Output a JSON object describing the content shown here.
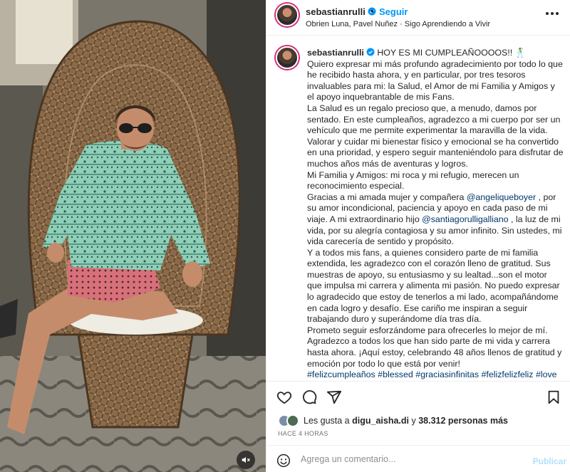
{
  "header": {
    "username": "sebastianrulli",
    "separator": "•",
    "follow_label": "Seguir",
    "subtitle": "Obrien Luna, Pavel Nuñez · Sigo Aprendiendo a Vivir"
  },
  "caption": {
    "username": "sebastianrulli",
    "headline": "HOY ES MI CUMPLEAÑOOOOS!! 🕺",
    "p1": "Quiero expresar mi más profundo agradecimiento por todo lo que he recibido hasta ahora, y en particular, por tres tesoros invaluables para mi: la Salud, el Amor de mi Familia y Amigos y el apoyo inquebrantable de mis Fans.",
    "p2": "La Salud es un regalo precioso que, a menudo, damos por sentado. En este cumpleaños, agradezco a mi cuerpo por ser un vehículo que me permite experimentar la maravilla de la vida. Valorar y cuidar mi bienestar físico y emocional se ha convertido en una prioridad, y espero seguir manteniéndolo para disfrutar de muchos años más de aventuras y logros.",
    "p3": "Mi Familia y Amigos: mi roca y mi refugio, merecen un reconocimiento especial.",
    "p4a": "Gracias a mi amada mujer y compañera ",
    "mention1": "@angeliqueboyer",
    "p4b": " , por su amor incondicional, paciencia y apoyo en cada paso de mi viaje. A mi extraordinario hijo ",
    "mention2": "@santiagorulligalliano",
    "p4c": " , la luz de mi vida, por su alegría contagiosa y su amor infinito. Sin ustedes, mi vida carecería de sentido y propósito.",
    "p5": "Y a todos mis fans, a quienes considero parte de mi familia extendida, les agradezco con el corazón lleno de gratitud. Sus muestras de apoyo, su entusiasmo y su lealtad...son el motor que impulsa mi carrera y alimenta mi pasión. No puedo expresar lo agradecido que estoy de tenerlos a mi lado, acompañándome en cada logro y desafío. Ese cariño me inspiran a seguir trabajando duro y superándome día tras día.",
    "p6": "Prometo seguir esforzándome para ofrecerles lo mejor de mí. Agradezco a todos los que han sido parte de mi vida y carrera hasta ahora. ¡Aquí estoy, celebrando 48 años llenos de gratitud y emoción por todo lo que está por venir!",
    "tags": "#felizcumpleaños #blessed #graciasinfinitas #felizfelizfeliz #love"
  },
  "likes": {
    "prefix": "Les gusta a ",
    "user": "digu_aisha.di",
    "middle": " y ",
    "count": "38.312 personas más"
  },
  "timestamp": "HACE 4 HORAS",
  "comment": {
    "placeholder": "Agrega un comentario...",
    "publish_label": "Publicar"
  },
  "icons": {
    "verified": "verified-badge-icon",
    "more": "more-options-icon",
    "like": "heart-icon",
    "comment": "comment-icon",
    "share": "send-icon",
    "save": "bookmark-icon",
    "emoji": "emoji-icon",
    "mute": "audio-muted-icon"
  },
  "colors": {
    "accent": "#0095f6",
    "link": "#00376b",
    "verified": "#0095f6"
  }
}
